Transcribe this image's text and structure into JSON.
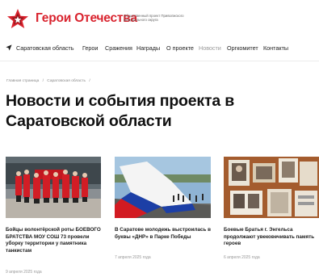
{
  "header": {
    "site_title": "Герои Отечества",
    "site_subtitle": "Общественный проект Приволжского федерального округа"
  },
  "nav": {
    "region": "Саратовская область",
    "items": [
      {
        "label": "Герои",
        "active": false
      },
      {
        "label": "Сражения",
        "active": false
      },
      {
        "label": "Награды",
        "active": false
      },
      {
        "label": "О проекте",
        "active": false
      },
      {
        "label": "Новости",
        "active": true
      },
      {
        "label": "Оргкомитет",
        "active": false
      },
      {
        "label": "Контакты",
        "active": false
      }
    ]
  },
  "breadcrumb": {
    "home": "Главная страница",
    "region": "Саратовская область",
    "separator": "/"
  },
  "page": {
    "title": "Новости и события проекта в Саратовской области"
  },
  "cards": [
    {
      "title": "Бойцы волонтёрской роты БОЕВОГО БРАТСТВА МОУ СОШ 73 провели уборку территории у памятника танкистам",
      "date": "9 апреля 2025 года"
    },
    {
      "title": "В Саратове молодежь выстроилась в буквы «ДНР» в Парке Победы",
      "date": "7 апреля 2025 года"
    },
    {
      "title": "Боевые Братья г. Энгельса продолжают увековечивать память героев",
      "date": "6 апреля 2025 года"
    }
  ],
  "colors": {
    "brand_red": "#d9232e",
    "muted_nav": "#9a9a9a",
    "text": "#111111"
  }
}
